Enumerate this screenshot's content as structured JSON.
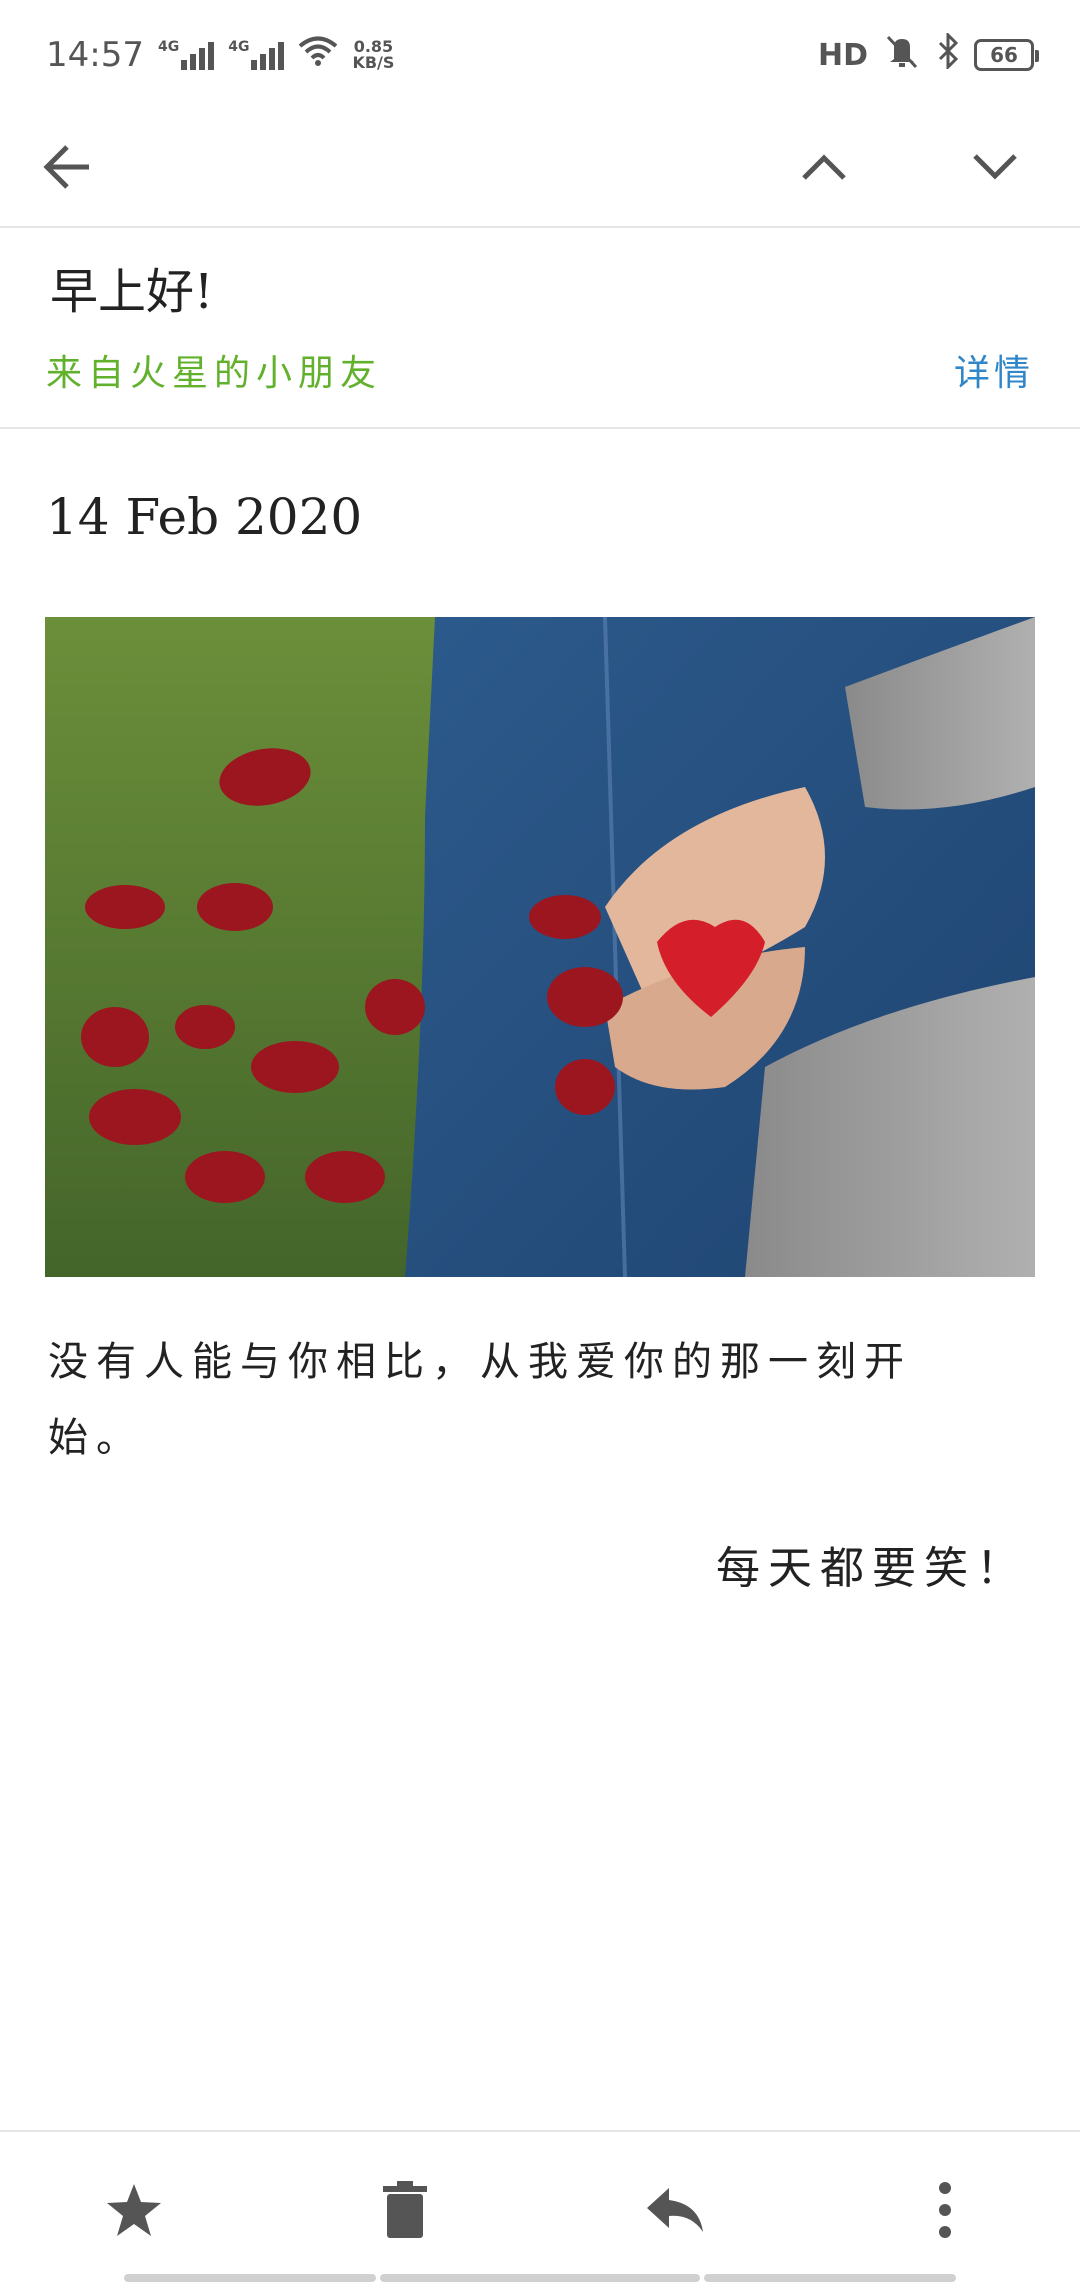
{
  "status_bar": {
    "time": "14:57",
    "network1": "4G",
    "network2": "4G",
    "speed_value": "0.85",
    "speed_unit": "KB/S",
    "hd_label": "HD",
    "battery": "66",
    "icons": [
      "signal-icon",
      "wifi-icon",
      "mute-icon",
      "bluetooth-icon",
      "battery-icon"
    ]
  },
  "toolbar": {
    "icons": [
      "back-arrow-icon",
      "chevron-up-icon",
      "chevron-down-icon"
    ]
  },
  "email": {
    "subject": "早上好!",
    "sender": "来自火星的小朋友",
    "details_label": "详情",
    "date": "14 Feb 2020",
    "body_line1": "没有人能与你相比，从我爱你的那一刻开",
    "body_line2": "始。",
    "closing": "每天都要笑！"
  },
  "bottom_bar": {
    "icons": [
      "star-icon",
      "trash-icon",
      "reply-icon",
      "more-vertical-icon"
    ]
  },
  "colors": {
    "sender_green": "#62b12c",
    "link_blue": "#2f86c8",
    "icon_gray": "#555555"
  }
}
